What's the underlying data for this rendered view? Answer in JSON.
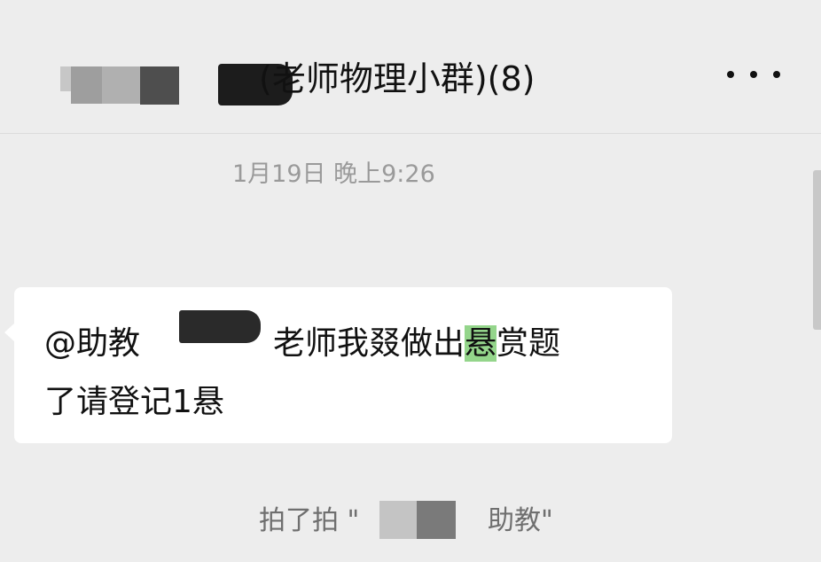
{
  "header": {
    "title": "(老师物理小群)(8)",
    "more_icon": "more-dots-icon"
  },
  "chat": {
    "timestamp": "1月19日 晚上9:26",
    "message": {
      "mention": "@助教",
      "text_line1": "老师我叕做出",
      "highlight": "悬",
      "text_line1_rest": "赏题",
      "text_line2": "了请登记1悬"
    },
    "system_notice": {
      "prefix": "拍了拍 \"",
      "suffix": "助教\""
    }
  },
  "colors": {
    "background": "#ededed",
    "bubble": "#ffffff",
    "highlight": "#94d58b"
  }
}
